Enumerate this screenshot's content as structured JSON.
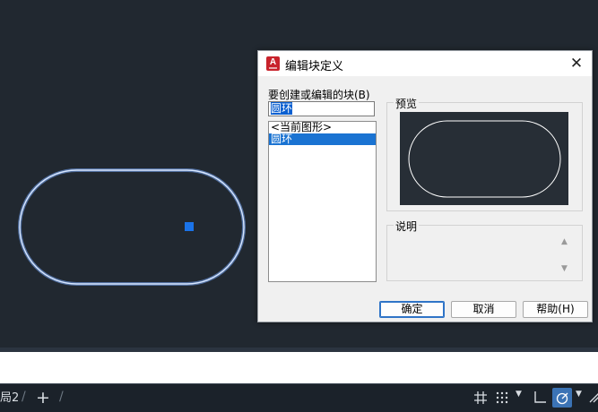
{
  "colors": {
    "canvas_bg": "#212830",
    "outline_highlight": "#a6c8ff",
    "grip": "#1a73e8",
    "selection": "#1a73d2"
  },
  "dialog": {
    "title": "编辑块定义",
    "app_icon": "A",
    "close_icon": "close-icon",
    "block_label": "要创建或编辑的块(B)",
    "block_name": "圆环",
    "list_items": [
      "<当前图形>",
      "圆环"
    ],
    "selected_index": 1,
    "preview_label": "预览",
    "description_label": "说明",
    "ok": "确定",
    "cancel": "取消",
    "help": "帮助(H)"
  },
  "statusbar": {
    "layout_tab": "局2",
    "add_icon": "plus-icon",
    "grid_icon": "grid-icon",
    "snap_icon": "snap-dots-icon",
    "ortho_icon": "ortho-icon",
    "polar_icon": "polar-tracking-icon"
  }
}
